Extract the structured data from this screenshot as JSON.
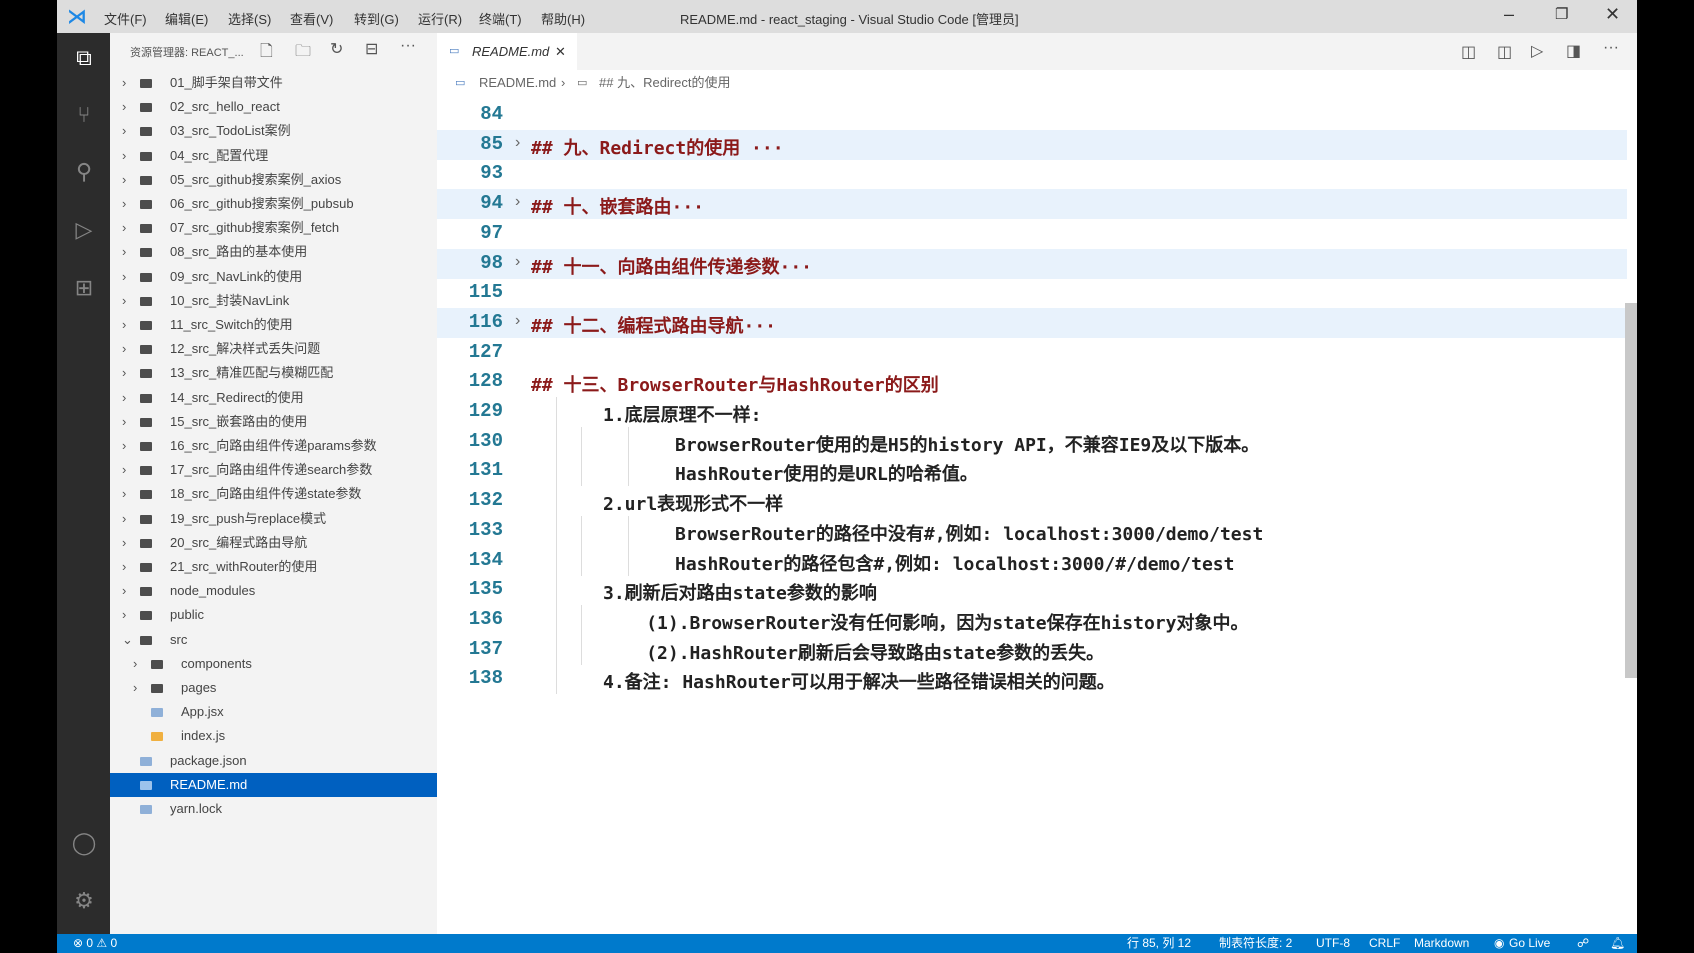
{
  "titlebar": {
    "menus": [
      "文件(F)",
      "编辑(E)",
      "选择(S)",
      "查看(V)",
      "转到(G)",
      "运行(R)",
      "终端(T)",
      "帮助(H)"
    ],
    "title": "README.md - react_staging - Visual Studio Code [管理员]"
  },
  "sidebar": {
    "header": "资源管理器: REACT_...",
    "items": [
      {
        "label": "01_脚手架自带文件",
        "type": "folder"
      },
      {
        "label": "02_src_hello_react",
        "type": "folder"
      },
      {
        "label": "03_src_TodoList案例",
        "type": "folder"
      },
      {
        "label": "04_src_配置代理",
        "type": "folder"
      },
      {
        "label": "05_src_github搜索案例_axios",
        "type": "folder"
      },
      {
        "label": "06_src_github搜索案例_pubsub",
        "type": "folder"
      },
      {
        "label": "07_src_github搜索案例_fetch",
        "type": "folder"
      },
      {
        "label": "08_src_路由的基本使用",
        "type": "folder"
      },
      {
        "label": "09_src_NavLink的使用",
        "type": "folder"
      },
      {
        "label": "10_src_封装NavLink",
        "type": "folder"
      },
      {
        "label": "11_src_Switch的使用",
        "type": "folder"
      },
      {
        "label": "12_src_解决样式丢失问题",
        "type": "folder"
      },
      {
        "label": "13_src_精准匹配与模糊匹配",
        "type": "folder"
      },
      {
        "label": "14_src_Redirect的使用",
        "type": "folder"
      },
      {
        "label": "15_src_嵌套路由的使用",
        "type": "folder"
      },
      {
        "label": "16_src_向路由组件传递params参数",
        "type": "folder"
      },
      {
        "label": "17_src_向路由组件传递search参数",
        "type": "folder"
      },
      {
        "label": "18_src_向路由组件传递state参数",
        "type": "folder"
      },
      {
        "label": "19_src_push与replace模式",
        "type": "folder"
      },
      {
        "label": "20_src_编程式路由导航",
        "type": "folder"
      },
      {
        "label": "21_src_withRouter的使用",
        "type": "folder"
      },
      {
        "label": "node_modules",
        "type": "folder"
      },
      {
        "label": "public",
        "type": "folder"
      },
      {
        "label": "src",
        "type": "open"
      },
      {
        "label": "components",
        "type": "folder",
        "indent": 1
      },
      {
        "label": "pages",
        "type": "folder",
        "indent": 1
      },
      {
        "label": "App.jsx",
        "type": "file",
        "indent": 1
      },
      {
        "label": "index.js",
        "type": "file",
        "indent": 1
      },
      {
        "label": "package.json",
        "type": "file"
      },
      {
        "label": "README.md",
        "type": "file",
        "selected": true
      },
      {
        "label": "yarn.lock",
        "type": "file"
      }
    ]
  },
  "tab": {
    "label": "README.md"
  },
  "breadcrumb": {
    "file": "README.md",
    "section": "## 九、Redirect的使用"
  },
  "code": [
    {
      "n": "84",
      "t": ""
    },
    {
      "n": "85",
      "t": "## 九、Redirect的使用 ···",
      "h": true,
      "fold": true
    },
    {
      "n": "93",
      "t": ""
    },
    {
      "n": "94",
      "t": "## 十、嵌套路由···",
      "h": true,
      "fold": true
    },
    {
      "n": "97",
      "t": ""
    },
    {
      "n": "98",
      "t": "## 十一、向路由组件传递参数···",
      "h": true,
      "fold": true
    },
    {
      "n": "115",
      "t": ""
    },
    {
      "n": "116",
      "t": "## 十二、编程式路由导航···",
      "h": true,
      "fold": true
    },
    {
      "n": "127",
      "t": ""
    },
    {
      "n": "128",
      "t": "## 十三、BrowserRouter与HashRouter的区别",
      "h": true
    },
    {
      "n": "129",
      "t": "1.底层原理不一样:",
      "i": 1
    },
    {
      "n": "130",
      "t": "BrowserRouter使用的是H5的history API，不兼容IE9及以下版本。",
      "i": 2
    },
    {
      "n": "131",
      "t": "HashRouter使用的是URL的哈希值。",
      "i": 2
    },
    {
      "n": "132",
      "t": "2.url表现形式不一样",
      "i": 1
    },
    {
      "n": "133",
      "t": "BrowserRouter的路径中没有#,例如: localhost:3000/demo/test",
      "i": 2
    },
    {
      "n": "134",
      "t": "HashRouter的路径包含#,例如: localhost:3000/#/demo/test",
      "i": 2
    },
    {
      "n": "135",
      "t": "3.刷新后对路由state参数的影响",
      "i": 1
    },
    {
      "n": "136",
      "t": "(1).BrowserRouter没有任何影响，因为state保存在history对象中。",
      "i": 1.6
    },
    {
      "n": "137",
      "t": "(2).HashRouter刷新后会导致路由state参数的丢失。",
      "i": 1.6
    },
    {
      "n": "138",
      "t": "4.备注: HashRouter可以用于解决一些路径错误相关的问题。",
      "i": 1
    }
  ],
  "status": {
    "problems": "⊗ 0 ⚠ 0",
    "position": "行 85, 列 12",
    "tabsize": "制表符长度: 2",
    "encoding": "UTF-8",
    "eol": "CRLF",
    "language": "Markdown",
    "golive": "Go Live"
  }
}
